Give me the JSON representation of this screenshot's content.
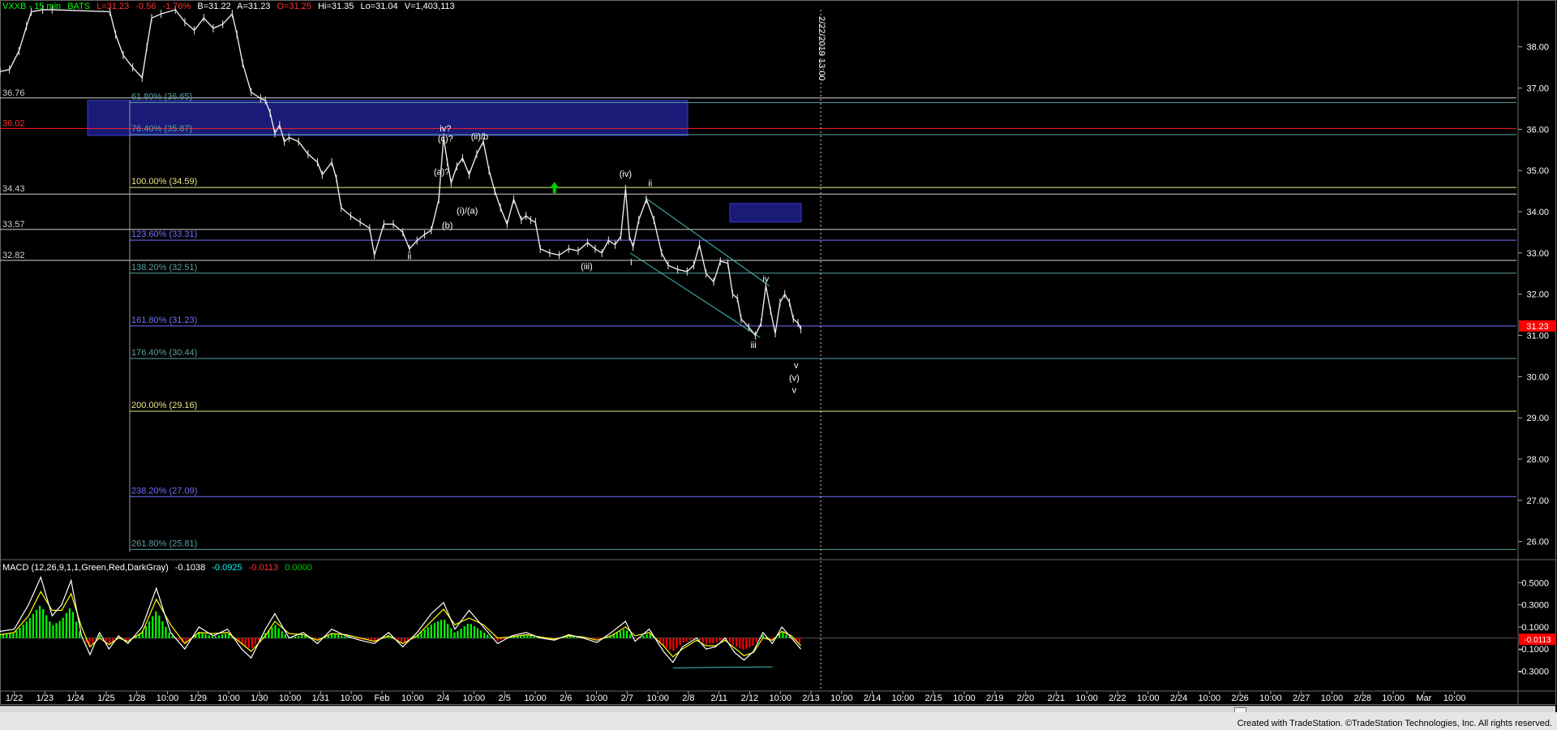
{
  "header": {
    "symbol": "VXXB - 15 min",
    "exchange": "BATS",
    "last": "L=31.23",
    "change": "-0.56",
    "change_pct": "-1.76%",
    "bid": "B=31.22",
    "ask": "A=31.23",
    "open": "O=31.25",
    "high": "Hi=31.35",
    "low": "Lo=31.04",
    "volume": "V=1,403,113"
  },
  "macd_header": {
    "name": "MACD (12,26,9,1,1,Green,Red,DarkGray)",
    "v1": "-0.1038",
    "v2": "-0.0925",
    "v3": "-0.0113",
    "v4": "0.0000"
  },
  "credit": "Created with TradeStation. ©TradeStation Technologies, Inc. All rights reserved.",
  "colors": {
    "background": "#000000",
    "price_bar": "#e8e8e8",
    "macd_green": "#00ff00",
    "macd_red": "#ff0000",
    "macd_line": "#ffffff",
    "signal_line": "#ffff00",
    "fib_yellow": "#e8e88a",
    "fib_blue": "#7070ff",
    "fib_teal": "#5aa0a0",
    "level_red": "#ff2020",
    "channel": "#40c0c0",
    "box": "#1e1e8c",
    "arrow": "#00cc00"
  },
  "chart_data": {
    "type": "line",
    "title": "VXXB - 15 min",
    "price_axis": {
      "ylim": [
        25.6,
        38.9
      ],
      "ticks": [
        "38.00",
        "37.00",
        "36.00",
        "35.00",
        "34.00",
        "33.00",
        "32.00",
        "31.00",
        "30.00",
        "29.00",
        "28.00",
        "27.00",
        "26.00"
      ],
      "current_price": "31.23"
    },
    "time_axis": {
      "ticks": [
        "1/22",
        "1/23",
        "1/24",
        "1/25",
        "1/28",
        "10:00",
        "1/29",
        "10:00",
        "1/30",
        "10:00",
        "1/31",
        "10:00",
        "Feb",
        "10:00",
        "2/4",
        "10:00",
        "2/5",
        "10:00",
        "2/6",
        "10:00",
        "2/7",
        "10:00",
        "2/8",
        "2/11",
        "2/12",
        "10:00",
        "2/13",
        "10:00",
        "2/14",
        "10:00",
        "2/15",
        "10:00",
        "2/19",
        "2/20",
        "2/21",
        "10:00",
        "2/22",
        "10:00",
        "2/24",
        "10:00",
        "2/26",
        "10:00",
        "2/27",
        "10:00",
        "2/28",
        "10:00",
        "Mar",
        "10:00"
      ],
      "vertical_marker": "2/22/2019 13:00"
    },
    "left_levels": [
      {
        "label": "36.76",
        "value": 36.76
      },
      {
        "label": "36.02",
        "value": 36.02
      },
      {
        "label": "34.43",
        "value": 34.43
      },
      {
        "label": "33.57",
        "value": 33.57
      },
      {
        "label": "32.82",
        "value": 32.82
      }
    ],
    "fib_levels": [
      {
        "label": "61.80% (36.65)",
        "value": 36.65,
        "color": "teal"
      },
      {
        "label": "76.40% (35.87)",
        "value": 35.87,
        "color": "teal"
      },
      {
        "label": "100.00% (34.59)",
        "value": 34.59,
        "color": "yellow"
      },
      {
        "label": "123.60% (33.31)",
        "value": 33.31,
        "color": "blue"
      },
      {
        "label": "138.20% (32.51)",
        "value": 32.51,
        "color": "teal"
      },
      {
        "label": "161.80% (31.23)",
        "value": 31.23,
        "color": "blue"
      },
      {
        "label": "176.40% (30.44)",
        "value": 30.44,
        "color": "teal"
      },
      {
        "label": "200.00% (29.16)",
        "value": 29.16,
        "color": "yellow"
      },
      {
        "label": "238.20% (27.09)",
        "value": 27.09,
        "color": "blue"
      },
      {
        "label": "261.80% (25.81)",
        "value": 25.81,
        "color": "teal"
      }
    ],
    "wave_labels": [
      {
        "text": "iv?",
        "t": 47.0,
        "price": 35.95
      },
      {
        "text": "(c)?",
        "t": 47.0,
        "price": 35.7
      },
      {
        "text": "(ii)/b",
        "t": 50.6,
        "price": 35.75
      },
      {
        "text": "(a)?",
        "t": 46.6,
        "price": 34.9
      },
      {
        "text": "(i)/(a)",
        "t": 49.3,
        "price": 33.95
      },
      {
        "text": "(b)",
        "t": 47.2,
        "price": 33.6
      },
      {
        "text": "ii",
        "t": 43.2,
        "price": 32.85
      },
      {
        "text": "(iv)",
        "t": 66.0,
        "price": 34.85
      },
      {
        "text": "ii",
        "t": 68.6,
        "price": 34.62
      },
      {
        "text": "(iii)",
        "t": 61.9,
        "price": 32.6
      },
      {
        "text": "i",
        "t": 66.6,
        "price": 32.7
      },
      {
        "text": "iv",
        "t": 80.8,
        "price": 32.3
      },
      {
        "text": "iii",
        "t": 79.5,
        "price": 30.7
      },
      {
        "text": "v",
        "t": 84.0,
        "price": 30.2
      },
      {
        "text": "(v)",
        "t": 83.8,
        "price": 29.9
      },
      {
        "text": "v",
        "t": 83.8,
        "price": 29.6
      }
    ],
    "price_series": {
      "name": "VXXB",
      "points": [
        [
          0.0,
          37.4
        ],
        [
          1.0,
          37.45
        ],
        [
          2.0,
          37.9
        ],
        [
          2.8,
          38.5
        ],
        [
          3.3,
          38.85
        ],
        [
          4.5,
          38.9
        ],
        [
          5.5,
          38.9
        ],
        [
          11.6,
          38.85
        ],
        [
          12.2,
          38.3
        ],
        [
          13.0,
          37.8
        ],
        [
          14.0,
          37.5
        ],
        [
          15.0,
          37.25
        ],
        [
          15.5,
          38.0
        ],
        [
          16.0,
          38.7
        ],
        [
          17.0,
          38.8
        ],
        [
          18.5,
          38.9
        ],
        [
          19.5,
          38.6
        ],
        [
          20.5,
          38.4
        ],
        [
          21.5,
          38.7
        ],
        [
          22.5,
          38.45
        ],
        [
          23.5,
          38.55
        ],
        [
          24.5,
          38.8
        ],
        [
          25.0,
          38.3
        ],
        [
          25.6,
          37.6
        ],
        [
          26.5,
          36.9
        ],
        [
          27.5,
          36.75
        ],
        [
          28.0,
          36.7
        ],
        [
          28.5,
          36.4
        ],
        [
          29.0,
          35.9
        ],
        [
          29.5,
          36.1
        ],
        [
          30.0,
          35.7
        ],
        [
          30.5,
          35.8
        ],
        [
          31.5,
          35.7
        ],
        [
          32.5,
          35.4
        ],
        [
          33.5,
          35.2
        ],
        [
          34.0,
          34.9
        ],
        [
          35.0,
          35.2
        ],
        [
          35.5,
          34.8
        ],
        [
          36.0,
          34.1
        ],
        [
          37.0,
          33.9
        ],
        [
          38.0,
          33.75
        ],
        [
          39.0,
          33.6
        ],
        [
          39.5,
          32.95
        ],
        [
          40.5,
          33.7
        ],
        [
          41.5,
          33.7
        ],
        [
          42.5,
          33.5
        ],
        [
          43.2,
          33.1
        ],
        [
          44.0,
          33.3
        ],
        [
          44.8,
          33.45
        ],
        [
          45.5,
          33.55
        ],
        [
          46.3,
          34.3
        ],
        [
          46.8,
          35.8
        ],
        [
          47.2,
          35.2
        ],
        [
          47.6,
          34.7
        ],
        [
          48.2,
          35.1
        ],
        [
          48.8,
          35.3
        ],
        [
          49.5,
          34.9
        ],
        [
          50.3,
          35.4
        ],
        [
          51.0,
          35.7
        ],
        [
          51.6,
          35.0
        ],
        [
          52.2,
          34.5
        ],
        [
          52.8,
          34.1
        ],
        [
          53.5,
          33.7
        ],
        [
          54.2,
          34.3
        ],
        [
          55.0,
          33.8
        ],
        [
          55.5,
          33.9
        ],
        [
          56.0,
          33.8
        ],
        [
          56.5,
          33.75
        ],
        [
          57.0,
          33.1
        ],
        [
          58.0,
          33.0
        ],
        [
          59.0,
          32.95
        ],
        [
          60.0,
          33.1
        ],
        [
          61.0,
          33.05
        ],
        [
          62.0,
          33.25
        ],
        [
          62.8,
          33.1
        ],
        [
          63.5,
          33.0
        ],
        [
          64.2,
          33.3
        ],
        [
          64.9,
          33.2
        ],
        [
          65.5,
          33.4
        ],
        [
          66.0,
          34.55
        ],
        [
          66.4,
          33.4
        ],
        [
          66.8,
          33.15
        ],
        [
          67.4,
          33.8
        ],
        [
          68.2,
          34.3
        ],
        [
          69.0,
          33.8
        ],
        [
          69.8,
          33.0
        ],
        [
          70.5,
          32.7
        ],
        [
          71.5,
          32.6
        ],
        [
          72.5,
          32.55
        ],
        [
          73.2,
          32.7
        ],
        [
          73.8,
          33.2
        ],
        [
          74.5,
          32.5
        ],
        [
          75.3,
          32.3
        ],
        [
          76.0,
          32.8
        ],
        [
          76.8,
          32.75
        ],
        [
          77.3,
          32.0
        ],
        [
          77.8,
          31.9
        ],
        [
          78.2,
          31.4
        ],
        [
          79.0,
          31.2
        ],
        [
          79.7,
          31.0
        ],
        [
          80.3,
          31.3
        ],
        [
          80.8,
          32.2
        ],
        [
          81.3,
          31.6
        ],
        [
          81.8,
          31.05
        ],
        [
          82.3,
          31.8
        ],
        [
          82.8,
          32.0
        ],
        [
          83.3,
          31.8
        ],
        [
          83.7,
          31.4
        ],
        [
          84.2,
          31.3
        ],
        [
          84.5,
          31.15
        ]
      ]
    },
    "macd": {
      "ylim": [
        -0.45,
        0.62
      ],
      "ticks": [
        "0.5000",
        "0.3000",
        "0.1000",
        "-0.1000",
        "-0.3000"
      ],
      "current": "-0.0113",
      "macd_line": [
        [
          0.0,
          0.06
        ],
        [
          1.5,
          0.08
        ],
        [
          3.0,
          0.3
        ],
        [
          4.3,
          0.55
        ],
        [
          5.5,
          0.2
        ],
        [
          6.5,
          0.3
        ],
        [
          7.5,
          0.52
        ],
        [
          8.6,
          0.02
        ],
        [
          9.5,
          -0.15
        ],
        [
          10.5,
          0.05
        ],
        [
          11.5,
          -0.1
        ],
        [
          12.5,
          0.02
        ],
        [
          13.5,
          -0.05
        ],
        [
          15.0,
          0.1
        ],
        [
          16.5,
          0.45
        ],
        [
          18.0,
          0.05
        ],
        [
          19.5,
          -0.1
        ],
        [
          21.0,
          0.1
        ],
        [
          22.5,
          0.02
        ],
        [
          24.0,
          0.08
        ],
        [
          25.5,
          -0.1
        ],
        [
          26.5,
          -0.18
        ],
        [
          28.0,
          0.08
        ],
        [
          29.0,
          0.22
        ],
        [
          30.5,
          0.0
        ],
        [
          32.0,
          0.05
        ],
        [
          33.5,
          -0.05
        ],
        [
          35.0,
          0.08
        ],
        [
          36.5,
          0.02
        ],
        [
          38.0,
          -0.02
        ],
        [
          39.5,
          -0.05
        ],
        [
          41.0,
          0.05
        ],
        [
          42.5,
          -0.08
        ],
        [
          44.0,
          0.05
        ],
        [
          45.5,
          0.22
        ],
        [
          46.8,
          0.32
        ],
        [
          48.0,
          0.08
        ],
        [
          49.5,
          0.25
        ],
        [
          51.0,
          0.1
        ],
        [
          52.5,
          -0.05
        ],
        [
          54.0,
          0.02
        ],
        [
          55.5,
          0.05
        ],
        [
          57.0,
          0.0
        ],
        [
          58.5,
          -0.02
        ],
        [
          60.0,
          0.03
        ],
        [
          61.5,
          0.0
        ],
        [
          63.0,
          -0.04
        ],
        [
          64.5,
          0.05
        ],
        [
          66.0,
          0.15
        ],
        [
          67.0,
          -0.03
        ],
        [
          68.5,
          0.08
        ],
        [
          70.0,
          -0.12
        ],
        [
          71.0,
          -0.22
        ],
        [
          72.0,
          -0.08
        ],
        [
          73.5,
          0.0
        ],
        [
          74.5,
          -0.1
        ],
        [
          75.5,
          -0.08
        ],
        [
          76.5,
          0.0
        ],
        [
          77.5,
          -0.13
        ],
        [
          78.5,
          -0.2
        ],
        [
          79.5,
          -0.12
        ],
        [
          80.5,
          0.05
        ],
        [
          81.5,
          -0.05
        ],
        [
          82.5,
          0.1
        ],
        [
          83.5,
          0.0
        ],
        [
          84.5,
          -0.1
        ]
      ],
      "signal_line": [
        [
          0.0,
          0.03
        ],
        [
          1.5,
          0.05
        ],
        [
          3.0,
          0.2
        ],
        [
          4.3,
          0.42
        ],
        [
          5.5,
          0.25
        ],
        [
          6.5,
          0.25
        ],
        [
          7.5,
          0.4
        ],
        [
          8.6,
          0.1
        ],
        [
          9.5,
          -0.08
        ],
        [
          10.5,
          0.0
        ],
        [
          11.5,
          -0.06
        ],
        [
          12.5,
          0.0
        ],
        [
          13.5,
          -0.03
        ],
        [
          15.0,
          0.05
        ],
        [
          16.5,
          0.35
        ],
        [
          18.0,
          0.12
        ],
        [
          19.5,
          -0.05
        ],
        [
          21.0,
          0.05
        ],
        [
          22.5,
          0.04
        ],
        [
          24.0,
          0.05
        ],
        [
          25.5,
          -0.05
        ],
        [
          26.5,
          -0.12
        ],
        [
          28.0,
          0.02
        ],
        [
          29.0,
          0.15
        ],
        [
          30.5,
          0.04
        ],
        [
          32.0,
          0.03
        ],
        [
          33.5,
          -0.02
        ],
        [
          35.0,
          0.04
        ],
        [
          36.5,
          0.03
        ],
        [
          38.0,
          0.0
        ],
        [
          39.5,
          -0.03
        ],
        [
          41.0,
          0.02
        ],
        [
          42.5,
          -0.05
        ],
        [
          44.0,
          0.02
        ],
        [
          45.5,
          0.15
        ],
        [
          46.8,
          0.26
        ],
        [
          48.0,
          0.12
        ],
        [
          49.5,
          0.18
        ],
        [
          51.0,
          0.12
        ],
        [
          52.5,
          0.0
        ],
        [
          54.0,
          0.01
        ],
        [
          55.5,
          0.03
        ],
        [
          57.0,
          0.01
        ],
        [
          58.5,
          -0.01
        ],
        [
          60.0,
          0.02
        ],
        [
          61.5,
          0.01
        ],
        [
          63.0,
          -0.02
        ],
        [
          64.5,
          0.02
        ],
        [
          66.0,
          0.1
        ],
        [
          67.0,
          0.02
        ],
        [
          68.5,
          0.05
        ],
        [
          70.0,
          -0.07
        ],
        [
          71.0,
          -0.17
        ],
        [
          72.0,
          -0.1
        ],
        [
          73.5,
          -0.02
        ],
        [
          74.5,
          -0.07
        ],
        [
          75.5,
          -0.07
        ],
        [
          76.5,
          -0.02
        ],
        [
          77.5,
          -0.09
        ],
        [
          78.5,
          -0.16
        ],
        [
          79.5,
          -0.13
        ],
        [
          80.5,
          0.0
        ],
        [
          81.5,
          -0.02
        ],
        [
          82.5,
          0.06
        ],
        [
          83.5,
          0.02
        ],
        [
          84.5,
          -0.07
        ]
      ]
    }
  }
}
